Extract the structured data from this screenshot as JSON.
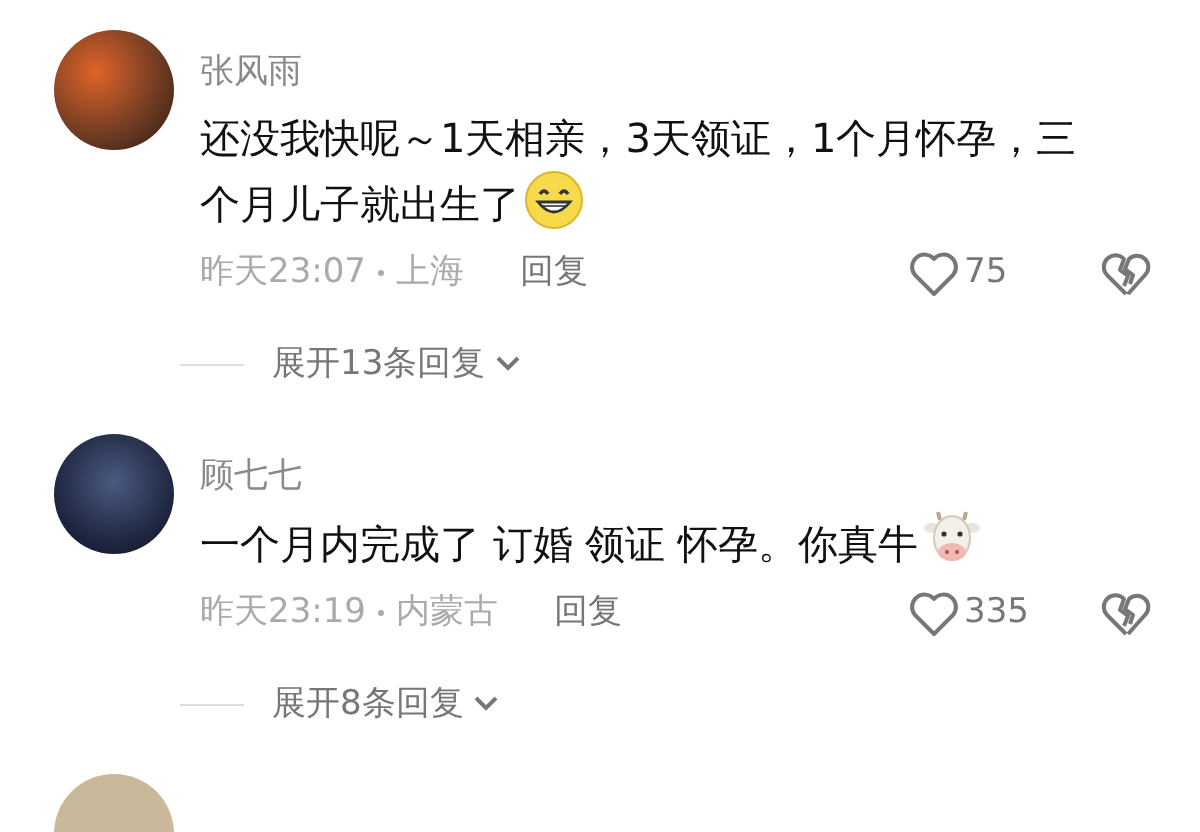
{
  "comments": [
    {
      "name": "张风雨",
      "text": "还没我快呢～1天相亲，3天领证，1个月怀孕，三个月儿子就出生了",
      "emoji": {
        "kind": "grin"
      },
      "time": "昨天23:07",
      "location": "上海",
      "reply": "回复",
      "likes": "75",
      "expand": "展开13条回复"
    },
    {
      "name": "顾七七",
      "text": "一个月内完成了 订婚 领证 怀孕。你真牛",
      "emoji": {
        "kind": "cow"
      },
      "time": "昨天23:19",
      "location": "内蒙古",
      "reply": "回复",
      "likes": "335",
      "expand": "展开8条回复"
    }
  ]
}
